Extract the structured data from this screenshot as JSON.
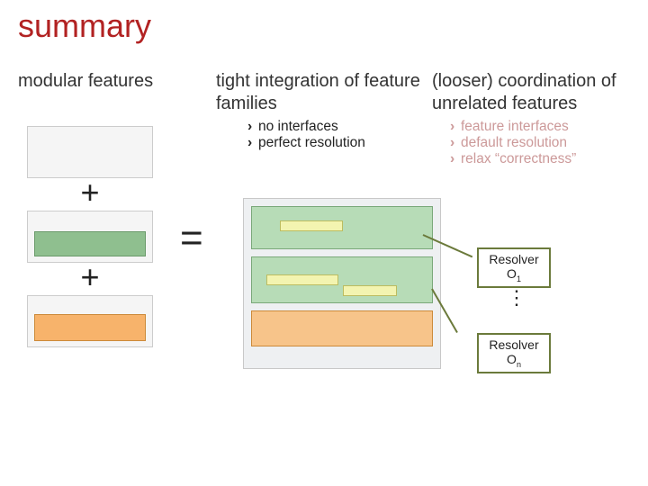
{
  "title": "summary",
  "columns": {
    "modular": {
      "heading": "modular features"
    },
    "tight": {
      "heading": "tight integration of feature families",
      "bullets": [
        "no interfaces",
        "perfect resolution"
      ]
    },
    "looser": {
      "heading": "(looser) coordination of unrelated features",
      "bullets": [
        "feature interfaces",
        "default resolution",
        "relax “correctness”"
      ]
    }
  },
  "operators": {
    "plus": "+",
    "equals": "="
  },
  "resolvers": {
    "label": "Resolver",
    "first_index": "1",
    "last_index": "n",
    "ellipsis": "⋮"
  },
  "bullet_glyph": "›"
}
